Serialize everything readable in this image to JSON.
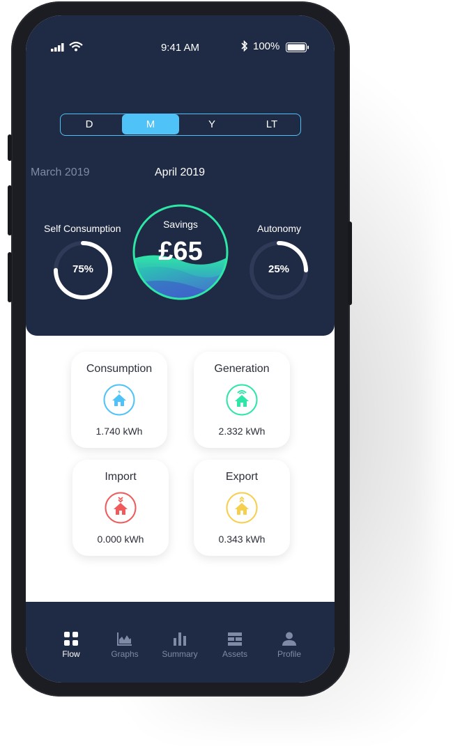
{
  "status_bar": {
    "time": "9:41 AM",
    "battery": "100%"
  },
  "period_selector": {
    "options": [
      "D",
      "M",
      "Y",
      "LT"
    ],
    "selected": "M"
  },
  "months": {
    "previous": "March 2019",
    "current": "April 2019"
  },
  "metrics": {
    "self_consumption": {
      "label": "Self Consumption",
      "value": "75%",
      "fraction": 0.75
    },
    "savings": {
      "label": "Savings",
      "value": "£65"
    },
    "autonomy": {
      "label": "Autonomy",
      "value": "25%",
      "fraction": 0.25
    }
  },
  "cards": [
    {
      "title": "Consumption",
      "value": "1.740 kWh",
      "color": "#4fc3f7",
      "icon": "consumption-house-icon"
    },
    {
      "title": "Generation",
      "value": "2.332 kWh",
      "color": "#2ee6a6",
      "icon": "generation-house-icon"
    },
    {
      "title": "Import",
      "value": "0.000 kWh",
      "color": "#f05a5a",
      "icon": "import-house-icon"
    },
    {
      "title": "Export",
      "value": "0.343 kWh",
      "color": "#f6cf4d",
      "icon": "export-house-icon"
    }
  ],
  "tabs": [
    {
      "label": "Flow",
      "icon": "flow-icon",
      "active": true
    },
    {
      "label": "Graphs",
      "icon": "graphs-icon",
      "active": false
    },
    {
      "label": "Summary",
      "icon": "summary-icon",
      "active": false
    },
    {
      "label": "Assets",
      "icon": "assets-icon",
      "active": false
    },
    {
      "label": "Profile",
      "icon": "profile-icon",
      "active": false
    }
  ],
  "colors": {
    "panel": "#1f2a44",
    "accent": "#4fc3f7",
    "ring": "#ffffff",
    "ring_track": "#2e3a57"
  }
}
